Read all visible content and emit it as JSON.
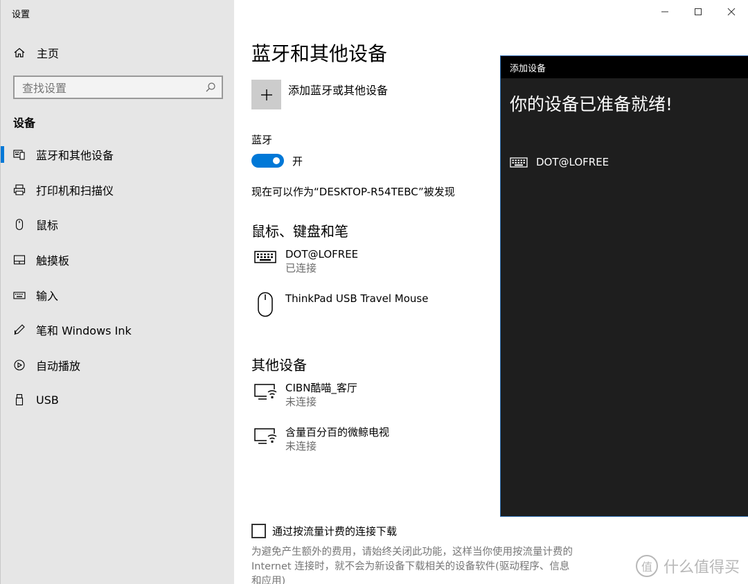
{
  "app": {
    "title": "设置"
  },
  "sidebar": {
    "home_label": "主页",
    "search_placeholder": "查找设置",
    "section_title": "设备",
    "items": [
      {
        "label": "蓝牙和其他设备",
        "icon": "bluetooth-device-icon",
        "active": true
      },
      {
        "label": "打印机和扫描仪",
        "icon": "printer-icon"
      },
      {
        "label": "鼠标",
        "icon": "mouse-icon"
      },
      {
        "label": "触摸板",
        "icon": "touchpad-icon"
      },
      {
        "label": "输入",
        "icon": "keyboard-icon"
      },
      {
        "label": "笔和 Windows Ink",
        "icon": "pen-icon"
      },
      {
        "label": "自动播放",
        "icon": "autoplay-icon"
      },
      {
        "label": "USB",
        "icon": "usb-icon"
      }
    ]
  },
  "main": {
    "title": "蓝牙和其他设备",
    "add_device_label": "添加蓝牙或其他设备",
    "bluetooth_label": "蓝牙",
    "bluetooth_state": "开",
    "discoverable_text": "现在可以作为“DESKTOP-R54TEBC”被发现",
    "input_section_title": "鼠标、键盘和笔",
    "input_devices": [
      {
        "name": "DOT@LOFREE",
        "status": "已连接",
        "icon": "keyboard-icon"
      },
      {
        "name": "ThinkPad USB Travel Mouse",
        "status": "",
        "icon": "mouse-icon"
      }
    ],
    "other_section_title": "其他设备",
    "other_devices": [
      {
        "name": "CIBN酷喵_客厅",
        "status": "未连接",
        "icon": "display-wireless-icon"
      },
      {
        "name": "含量百分百的微鲸电视",
        "status": "未连接",
        "icon": "display-wireless-icon"
      }
    ],
    "metered_label": "通过按流量计费的连接下载",
    "metered_note": "为避免产生额外的费用，请始终关闭此功能，这样当你使用按流量计费的 Internet 连接时，就不会为新设备下载相关的设备软件(驱动程序、信息和应用)"
  },
  "dialog": {
    "title": "添加设备",
    "heading": "你的设备已准备就绪!",
    "device_name": "DOT@LOFREE",
    "device_icon": "keyboard-icon"
  },
  "watermark": {
    "text": "什么值得买",
    "logo_glyph": "值"
  },
  "colors": {
    "accent": "#0078d7",
    "sidebar_bg": "#e6e6e6",
    "dialog_bg": "#1e1e1e"
  }
}
